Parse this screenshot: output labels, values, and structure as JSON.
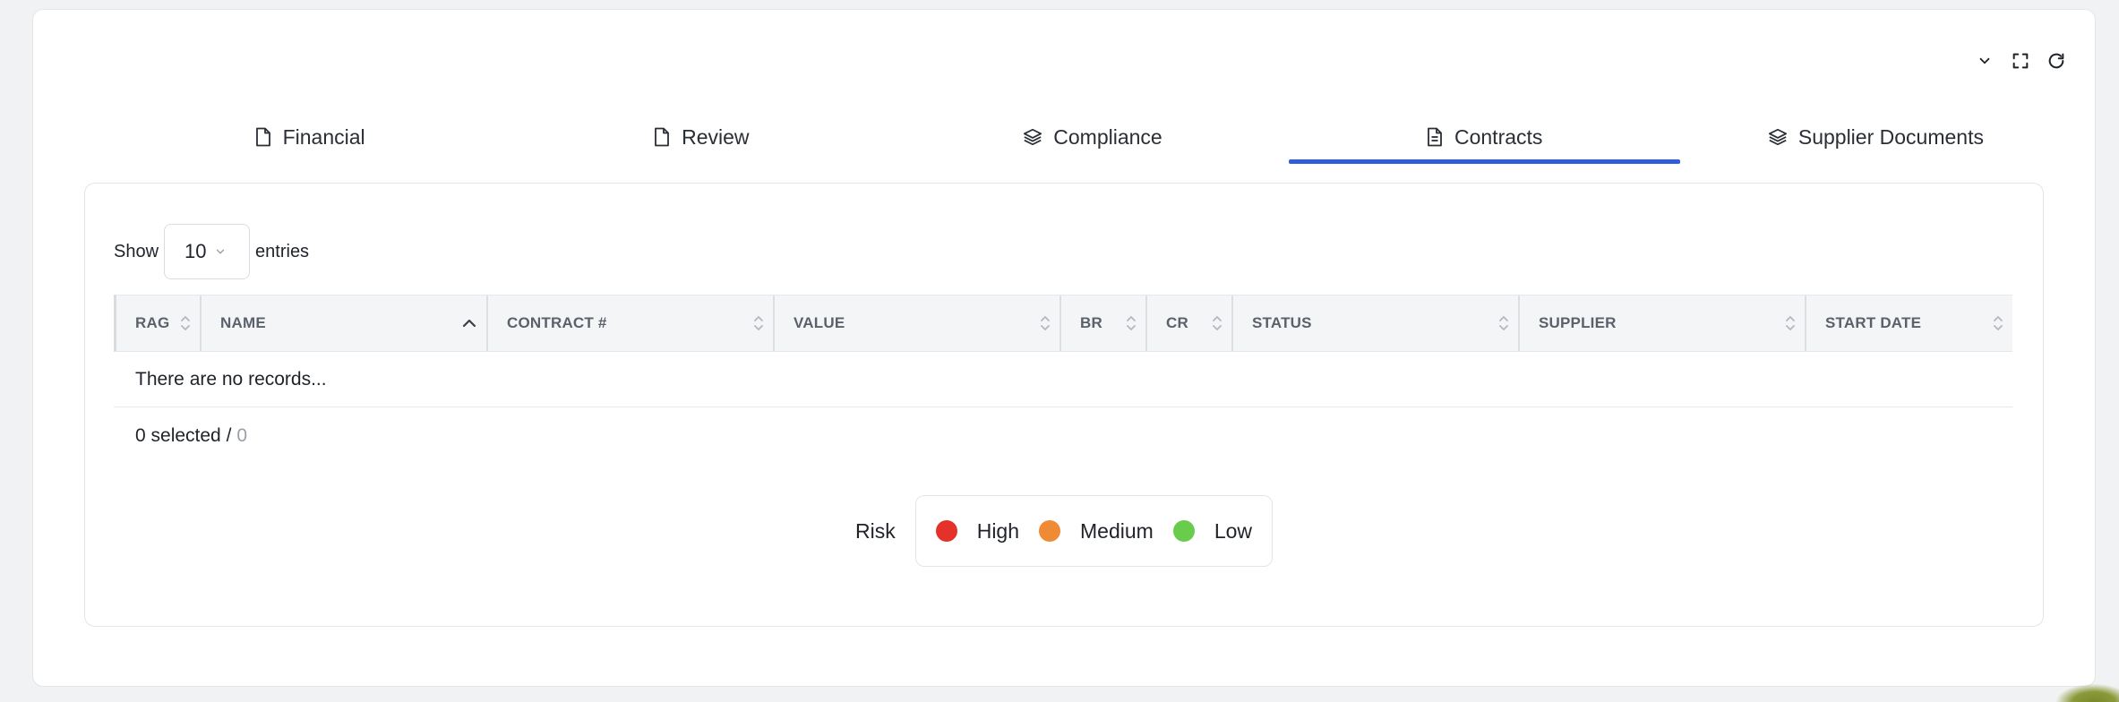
{
  "toolbar": {
    "collapse_icon": "chevron-down-icon",
    "fullscreen_icon": "expand-icon",
    "refresh_icon": "refresh-icon"
  },
  "tabs": [
    {
      "label": "Financial",
      "icon": "document-icon",
      "active": false
    },
    {
      "label": "Review",
      "icon": "document-icon",
      "active": false
    },
    {
      "label": "Compliance",
      "icon": "layers-icon",
      "active": false
    },
    {
      "label": "Contracts",
      "icon": "document-text-icon",
      "active": true
    },
    {
      "label": "Supplier Documents",
      "icon": "layers-icon",
      "active": false
    }
  ],
  "accent_color": "#2f5fd8",
  "show_entries": {
    "show_label": "Show",
    "selected_value": "10",
    "entries_label": "entries"
  },
  "table": {
    "columns": [
      "RAG",
      "NAME",
      "CONTRACT #",
      "VALUE",
      "BR",
      "CR",
      "STATUS",
      "SUPPLIER",
      "START DATE"
    ],
    "sorted_column": "NAME",
    "empty_message": "There are no records...",
    "selected_count_text": "0 selected /",
    "total_count": "0"
  },
  "legend": {
    "title": "Risk",
    "items": [
      {
        "label": "High",
        "color": "#e4322b"
      },
      {
        "label": "Medium",
        "color": "#ef8a35"
      },
      {
        "label": "Low",
        "color": "#6acc4c"
      }
    ]
  }
}
